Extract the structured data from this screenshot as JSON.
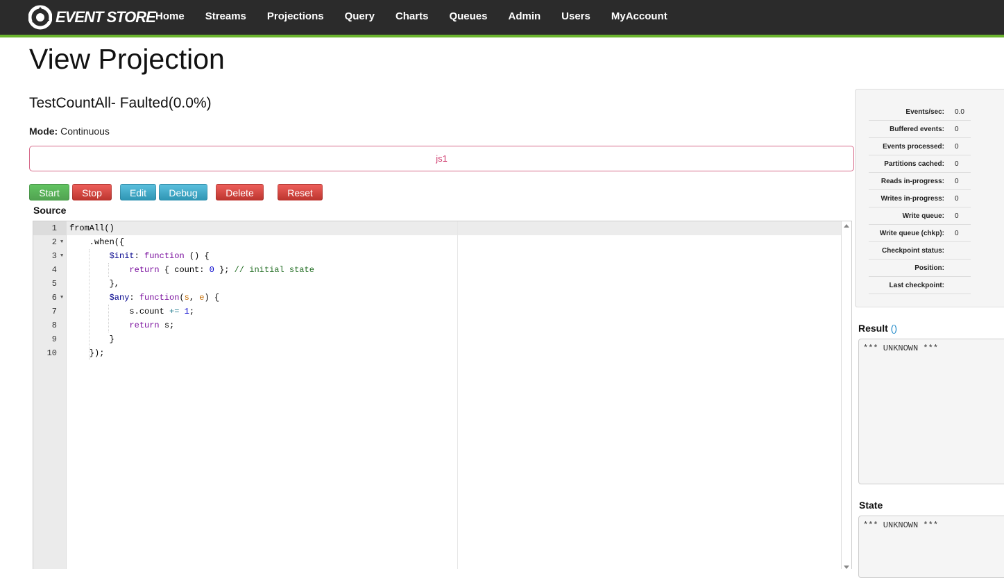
{
  "brand": {
    "name": "EVENT STORE"
  },
  "nav": [
    "Home",
    "Streams",
    "Projections",
    "Query",
    "Charts",
    "Queues",
    "Admin",
    "Users",
    "MyAccount"
  ],
  "page": {
    "title": "View Projection",
    "subtitle": "TestCountAll- Faulted(0.0%)",
    "mode_label": "Mode:",
    "mode_value": "Continuous",
    "message": "js1"
  },
  "buttons": {
    "start": "Start",
    "stop": "Stop",
    "edit": "Edit",
    "debug": "Debug",
    "delete": "Delete",
    "reset": "Reset"
  },
  "colors": {
    "nav_bg": "#2b2b2b",
    "nav_accent": "#6ab42d",
    "error": "#cf3a6d"
  },
  "source": {
    "label": "Source",
    "line_numbers": [
      "1",
      "2",
      "3",
      "4",
      "5",
      "6",
      "7",
      "8",
      "9",
      "10"
    ],
    "lines": [
      "fromAll()",
      "    .when({",
      "        $init: function () {",
      "            return { count: 0 }; // initial state",
      "        },",
      "        $any: function(s, e) {",
      "            s.count += 1;",
      "            return s;",
      "        }",
      "    });"
    ]
  },
  "stats": [
    {
      "label": "Events/sec:",
      "value": "0.0"
    },
    {
      "label": "Buffered events:",
      "value": "0"
    },
    {
      "label": "Events processed:",
      "value": "0"
    },
    {
      "label": "Partitions cached:",
      "value": "0"
    },
    {
      "label": "Reads in-progress:",
      "value": "0"
    },
    {
      "label": "Writes in-progress:",
      "value": "0"
    },
    {
      "label": "Write queue:",
      "value": "0"
    },
    {
      "label": "Write queue (chkp):",
      "value": "0"
    },
    {
      "label": "Checkpoint status:",
      "value": ""
    },
    {
      "label": "Position:",
      "value": ""
    },
    {
      "label": "Last checkpoint:",
      "value": ""
    }
  ],
  "result": {
    "label": "Result",
    "link": "()",
    "content": "*** UNKNOWN ***"
  },
  "state": {
    "label": "State",
    "content": "*** UNKNOWN ***"
  }
}
